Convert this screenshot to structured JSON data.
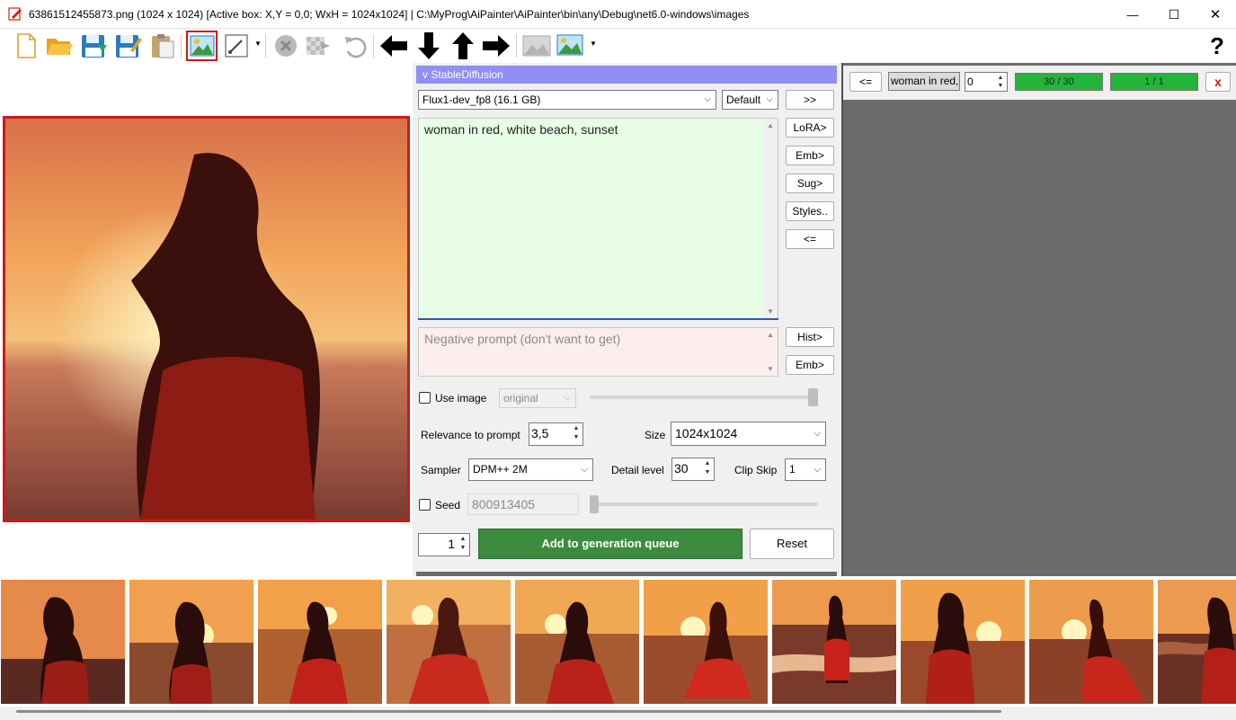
{
  "window": {
    "title": "63861512455873.png (1024 x 1024) [Active box: X,Y = 0,0; WxH = 1024x1024] | C:\\MyProg\\AiPainter\\AiPainter\\bin\\any\\Debug\\net6.0-windows\\images",
    "minimize_glyph": "—",
    "maximize_glyph": "☐",
    "close_glyph": "✕"
  },
  "toolbar": {
    "help_label": "?",
    "icons": [
      "new-file-icon",
      "open-folder-icon",
      "save-icon",
      "save-as-icon",
      "paste-icon",
      "image-view-icon",
      "brush-icon",
      "dropdown-icon",
      "cancel-icon",
      "apply-transparent-icon",
      "undo-icon",
      "arrow-left-icon",
      "arrow-down-icon",
      "arrow-up-icon",
      "arrow-right-icon",
      "gray-image-icon",
      "image-generate-icon",
      "dropdown-icon"
    ]
  },
  "stable_diffusion": {
    "header": "v StableDiffusion",
    "model": "Flux1-dev_fp8 (16.1 GB)",
    "vae": "Default",
    "expand_button": ">>",
    "prompt": "woman in red, white beach, sunset",
    "negative_placeholder": "Negative prompt (don't want to get)",
    "side_buttons": {
      "lora": "LoRA>",
      "emb": "Emb>",
      "sug": "Sug>",
      "styles": "Styles..",
      "back": "<=",
      "hist": "Hist>",
      "emb2": "Emb>"
    },
    "use_image_label": "Use image",
    "use_image_mode": "original",
    "use_image_checked": false,
    "relevance_label": "Relevance to prompt",
    "relevance_value": "3,5",
    "size_label": "Size",
    "size_value": "1024x1024",
    "sampler_label": "Sampler",
    "sampler_value": "DPM++ 2M",
    "detail_label": "Detail level",
    "detail_value": "30",
    "clip_skip_label": "Clip Skip",
    "clip_skip_value": "1",
    "seed_label": "Seed",
    "seed_value": "800913405",
    "seed_checked": false,
    "count_value": "1",
    "add_button": "Add to generation queue",
    "reset_button": "Reset"
  },
  "queue": {
    "back_button": "<=",
    "prompt_preview": "woman in red,",
    "counter_value": "0",
    "steps_progress": "30 / 30",
    "images_progress": "1 / 1",
    "close_button": "x"
  },
  "colors": {
    "selection_border": "#d01818",
    "accent_header": "#8f8ff5",
    "add_button": "#3c8c40",
    "progress_green": "#22b53a",
    "queue_background": "#6b6b6b"
  }
}
